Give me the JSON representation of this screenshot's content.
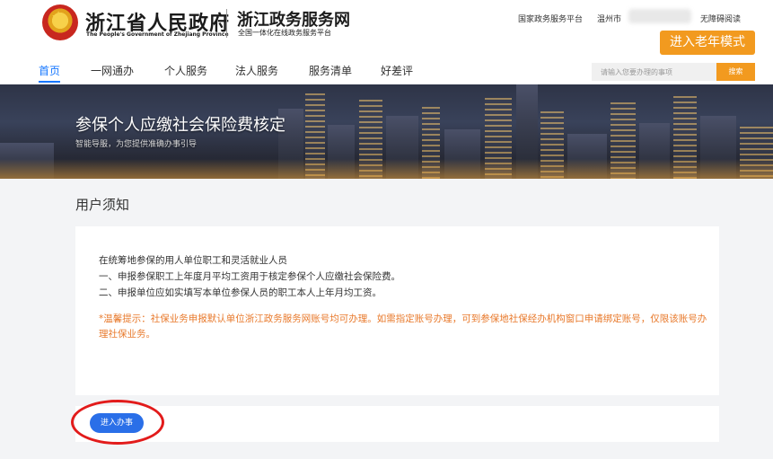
{
  "header": {
    "gov_title": "浙江省人民政府",
    "gov_subtitle": "The People's Government of Zhejiang Province",
    "portal_title": "浙江政务服务网",
    "portal_subtitle": "全国一体化在线政务服务平台",
    "top_links": {
      "national": "国家政务服务平台",
      "city": "温州市",
      "accessibility": "无障碍阅读"
    },
    "elder_mode": "进入老年模式",
    "icons": {
      "emblem": "national-emblem-icon"
    }
  },
  "nav": {
    "items": [
      "首页",
      "一网通办",
      "个人服务",
      "法人服务",
      "服务清单",
      "好差评"
    ],
    "active_index": 0
  },
  "search": {
    "placeholder": "请输入您要办理的事项",
    "button": "搜索"
  },
  "banner": {
    "title": "参保个人应缴社会保险费核定",
    "subtitle": "智能导服，为您提供准确办事引导"
  },
  "notice": {
    "section_title": "用户须知",
    "lines": [
      "在统筹地参保的用人单位职工和灵活就业人员",
      "一、申报参保职工上年度月平均工资用于核定参保个人应缴社会保险费。",
      "二、申报单位应如实填写本单位参保人员的职工本人上年月均工资。"
    ],
    "tip": "*温馨提示：社保业务申报默认单位浙江政务服务网账号均可办理。如需指定账号办理，可到参保地社保经办机构窗口申请绑定账号，仅限该账号办理社保业务。"
  },
  "actions": {
    "enter": "进入办事"
  },
  "colors": {
    "accent_orange": "#f29a1f",
    "nav_active": "#1677ff",
    "button_blue": "#2a6fe8",
    "tip_orange": "#e8792b",
    "highlight_red": "#e21b1b"
  }
}
